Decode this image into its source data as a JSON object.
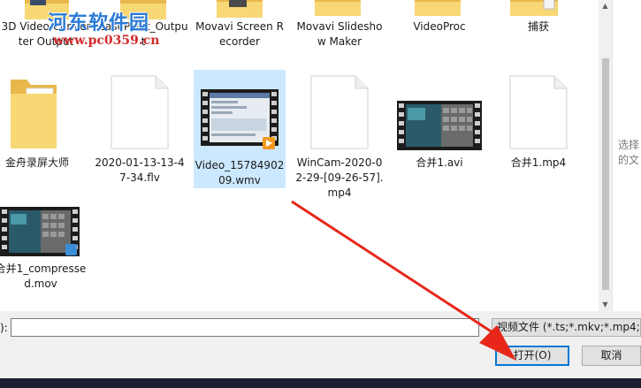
{
  "watermark": {
    "title": "河东软件园",
    "url": "www.pc0359.cn"
  },
  "files": [
    {
      "label": "3D Video Converter Output",
      "icon": "folder"
    },
    {
      "label": "EasePaint_Output",
      "icon": "folder"
    },
    {
      "label": "Movavi Screen Recorder",
      "icon": "folder"
    },
    {
      "label": "Movavi Slideshow Maker",
      "icon": "folder"
    },
    {
      "label": "VideoProc",
      "icon": "folder"
    },
    {
      "label": "捕获",
      "icon": "folder"
    },
    {
      "label": "金舟录屏大师",
      "icon": "folder"
    },
    {
      "label": "2020-01-13-13-47-34.flv",
      "icon": "blank-file"
    },
    {
      "label": "Video_1578490209.wmv",
      "icon": "video-thumbnail",
      "selected": true
    },
    {
      "label": "WinCam-2020-02-29-[09-26-57].mp4",
      "icon": "blank-file"
    },
    {
      "label": "合并1.avi",
      "icon": "video-thumbnail"
    },
    {
      "label": "合并1.mp4",
      "icon": "blank-file"
    },
    {
      "label": "合并1_compressed.mov",
      "icon": "video-thumbnail"
    }
  ],
  "preview": {
    "text_line1": "选择",
    "text_line2": "的文"
  },
  "filename": {
    "label": "):",
    "value": ""
  },
  "filter": {
    "value": "视频文件 (*.ts;*.mkv;*.mp4;*.a"
  },
  "buttons": {
    "open": "打开(O)",
    "cancel": "取消"
  },
  "colors": {
    "selection": "#cce8ff",
    "folder": "#f8d775",
    "accent": "#0078d7",
    "arrow": "#e8261a"
  }
}
